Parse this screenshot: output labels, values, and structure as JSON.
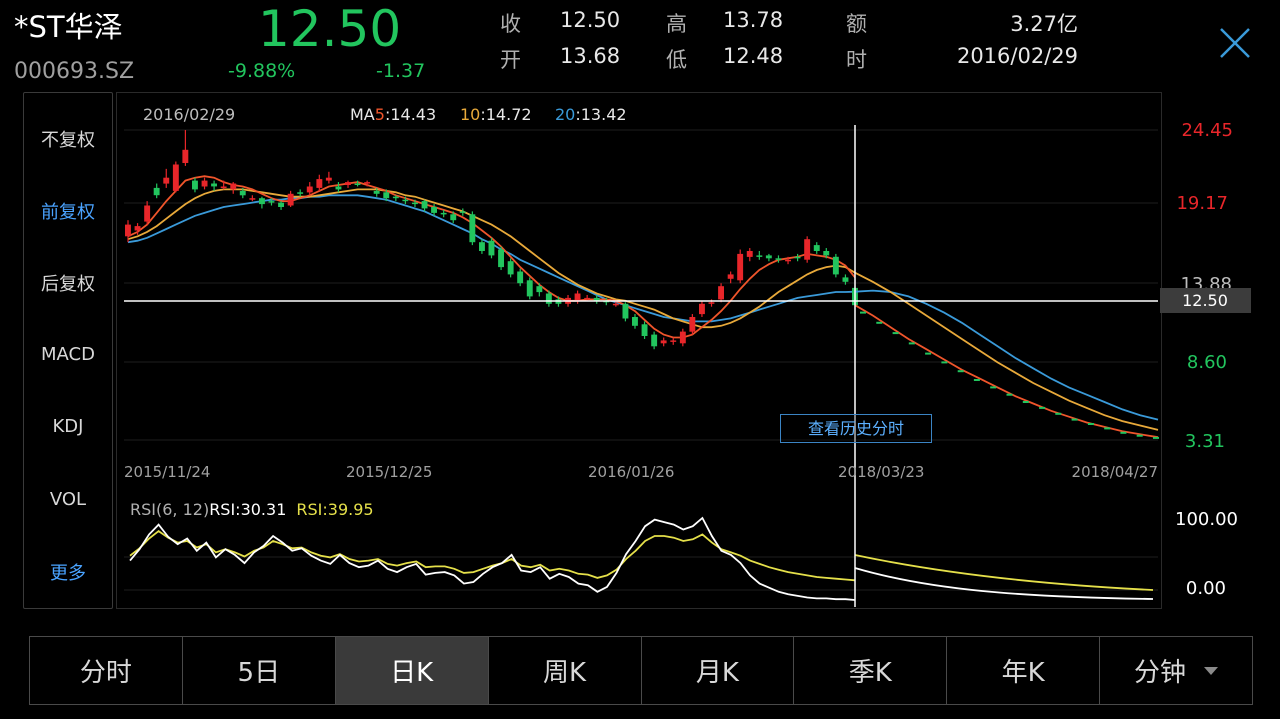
{
  "header": {
    "name": "*ST华泽",
    "code": "000693.SZ",
    "price": "12.50",
    "change_pct": "-9.88%",
    "change_abs": "-1.37",
    "quote": [
      {
        "label": "收",
        "value": "12.50"
      },
      {
        "label": "开",
        "value": "13.68"
      },
      {
        "label": "高",
        "value": "13.78"
      },
      {
        "label": "低",
        "value": "12.48"
      },
      {
        "label": "额",
        "value": "3.27亿"
      },
      {
        "label": "时",
        "value": "2016/02/29"
      }
    ]
  },
  "sidebar": {
    "items": [
      {
        "label": "不复权",
        "active": false
      },
      {
        "label": "前复权",
        "active": true
      },
      {
        "label": "后复权",
        "active": false
      },
      {
        "label": "MACD",
        "active": false
      },
      {
        "label": "KDJ",
        "active": false
      },
      {
        "label": "VOL",
        "active": false
      },
      {
        "label": "更多",
        "active": true
      }
    ]
  },
  "kline": {
    "date_label": "2016/02/29",
    "ma_prefix": "MA",
    "ma5_key": "5",
    "ma5_val": ":14.43",
    "ma10_key": "10",
    "ma10_val": ":14.72",
    "ma20_key": "20",
    "ma20_val": ":13.42",
    "price_ticks": [
      "24.45",
      "19.17",
      "13.88",
      "8.60",
      "3.31"
    ],
    "crosshair_value": "12.50",
    "date_ticks": [
      "2015/11/24",
      "2015/12/25",
      "2016/01/26",
      "2018/03/23",
      "2018/04/27"
    ],
    "history_button": "查看历史分时"
  },
  "rsi": {
    "label": "RSI(6, 12)",
    "rsi6": "RSI:30.31",
    "rsi12": "RSI:39.95",
    "ticks": [
      "100.00",
      "0.00"
    ]
  },
  "tabs": [
    {
      "label": "分时",
      "active": false
    },
    {
      "label": "5日",
      "active": false
    },
    {
      "label": "日K",
      "active": true
    },
    {
      "label": "周K",
      "active": false
    },
    {
      "label": "月K",
      "active": false
    },
    {
      "label": "季K",
      "active": false
    },
    {
      "label": "年K",
      "active": false
    },
    {
      "label": "分钟",
      "active": false
    }
  ],
  "colors": {
    "up": "#e8262a",
    "down": "#22c55e",
    "ma5": "#f0552b",
    "ma10": "#e8a93a",
    "ma20": "#3a9ad9",
    "rsi6": "#ffffff",
    "rsi12": "#e5e04a",
    "accent": "#4aa3ff"
  },
  "chart_data": {
    "type": "candlestick",
    "title": "",
    "ylim": [
      3.31,
      24.45
    ],
    "candles": [
      {
        "o": 17.2,
        "c": 18.0,
        "h": 18.3,
        "l": 16.8
      },
      {
        "o": 17.6,
        "c": 17.9,
        "h": 18.1,
        "l": 17.3
      },
      {
        "o": 18.2,
        "c": 19.3,
        "h": 19.6,
        "l": 18.0
      },
      {
        "o": 20.5,
        "c": 20.0,
        "h": 20.8,
        "l": 19.8
      },
      {
        "o": 20.8,
        "c": 21.2,
        "h": 21.8,
        "l": 20.5
      },
      {
        "o": 20.3,
        "c": 22.1,
        "h": 22.3,
        "l": 20.2
      },
      {
        "o": 22.2,
        "c": 23.1,
        "h": 24.45,
        "l": 22.0
      },
      {
        "o": 21.0,
        "c": 20.4,
        "h": 21.2,
        "l": 20.2
      },
      {
        "o": 20.6,
        "c": 21.0,
        "h": 21.2,
        "l": 20.4
      },
      {
        "o": 20.8,
        "c": 20.6,
        "h": 21.0,
        "l": 20.3
      },
      {
        "o": 20.6,
        "c": 20.6,
        "h": 21.0,
        "l": 20.4
      },
      {
        "o": 20.4,
        "c": 20.8,
        "h": 20.9,
        "l": 20.1
      },
      {
        "o": 20.3,
        "c": 20.0,
        "h": 20.5,
        "l": 19.8
      },
      {
        "o": 19.8,
        "c": 19.8,
        "h": 20.0,
        "l": 19.6
      },
      {
        "o": 19.8,
        "c": 19.4,
        "h": 19.9,
        "l": 19.1
      },
      {
        "o": 19.6,
        "c": 19.5,
        "h": 19.8,
        "l": 19.3
      },
      {
        "o": 19.5,
        "c": 19.2,
        "h": 19.6,
        "l": 19.0
      },
      {
        "o": 19.3,
        "c": 20.1,
        "h": 20.3,
        "l": 19.2
      },
      {
        "o": 20.2,
        "c": 20.1,
        "h": 20.4,
        "l": 19.9
      },
      {
        "o": 20.2,
        "c": 20.6,
        "h": 20.9,
        "l": 20.0
      },
      {
        "o": 20.5,
        "c": 21.1,
        "h": 21.4,
        "l": 20.3
      },
      {
        "o": 21.0,
        "c": 21.2,
        "h": 21.6,
        "l": 20.8
      },
      {
        "o": 20.6,
        "c": 20.4,
        "h": 20.9,
        "l": 20.2
      },
      {
        "o": 20.7,
        "c": 20.9,
        "h": 21.0,
        "l": 20.5
      },
      {
        "o": 20.8,
        "c": 20.7,
        "h": 21.0,
        "l": 20.6
      },
      {
        "o": 20.8,
        "c": 20.9,
        "h": 21.0,
        "l": 20.6
      },
      {
        "o": 20.3,
        "c": 20.1,
        "h": 20.5,
        "l": 19.9
      },
      {
        "o": 20.2,
        "c": 19.8,
        "h": 20.4,
        "l": 19.6
      },
      {
        "o": 19.9,
        "c": 19.8,
        "h": 20.0,
        "l": 19.6
      },
      {
        "o": 19.7,
        "c": 19.6,
        "h": 19.9,
        "l": 19.4
      },
      {
        "o": 19.5,
        "c": 19.4,
        "h": 19.7,
        "l": 19.2
      },
      {
        "o": 19.6,
        "c": 19.1,
        "h": 19.7,
        "l": 18.9
      },
      {
        "o": 19.2,
        "c": 18.8,
        "h": 19.4,
        "l": 18.6
      },
      {
        "o": 18.8,
        "c": 18.7,
        "h": 19.0,
        "l": 18.5
      },
      {
        "o": 18.7,
        "c": 18.3,
        "h": 18.9,
        "l": 18.1
      },
      {
        "o": 18.9,
        "c": 18.8,
        "h": 19.1,
        "l": 18.6
      },
      {
        "o": 18.7,
        "c": 16.8,
        "h": 18.9,
        "l": 16.6
      },
      {
        "o": 16.8,
        "c": 16.2,
        "h": 17.0,
        "l": 16.0
      },
      {
        "o": 16.9,
        "c": 15.9,
        "h": 17.1,
        "l": 15.7
      },
      {
        "o": 16.3,
        "c": 15.1,
        "h": 16.5,
        "l": 14.9
      },
      {
        "o": 15.5,
        "c": 14.6,
        "h": 15.7,
        "l": 14.4
      },
      {
        "o": 14.8,
        "c": 14.0,
        "h": 15.0,
        "l": 13.8
      },
      {
        "o": 14.2,
        "c": 13.1,
        "h": 14.4,
        "l": 12.9
      },
      {
        "o": 13.8,
        "c": 13.4,
        "h": 14.0,
        "l": 13.1
      },
      {
        "o": 13.3,
        "c": 12.6,
        "h": 13.5,
        "l": 12.4
      },
      {
        "o": 12.9,
        "c": 12.6,
        "h": 13.1,
        "l": 12.4
      },
      {
        "o": 12.6,
        "c": 13.0,
        "h": 13.2,
        "l": 12.4
      },
      {
        "o": 12.8,
        "c": 13.3,
        "h": 13.5,
        "l": 12.6
      },
      {
        "o": 13.0,
        "c": 13.0,
        "h": 13.2,
        "l": 12.8
      },
      {
        "o": 13.0,
        "c": 12.8,
        "h": 13.2,
        "l": 12.6
      },
      {
        "o": 12.8,
        "c": 12.7,
        "h": 13.0,
        "l": 12.5
      },
      {
        "o": 12.6,
        "c": 12.6,
        "h": 12.8,
        "l": 12.4
      },
      {
        "o": 12.6,
        "c": 11.6,
        "h": 12.7,
        "l": 11.4
      },
      {
        "o": 11.7,
        "c": 11.1,
        "h": 11.9,
        "l": 10.9
      },
      {
        "o": 11.2,
        "c": 10.4,
        "h": 11.4,
        "l": 10.2
      },
      {
        "o": 10.5,
        "c": 9.7,
        "h": 10.7,
        "l": 9.5
      },
      {
        "o": 9.9,
        "c": 10.1,
        "h": 10.3,
        "l": 9.7
      },
      {
        "o": 10.0,
        "c": 10.1,
        "h": 10.3,
        "l": 9.8
      },
      {
        "o": 9.9,
        "c": 10.7,
        "h": 10.9,
        "l": 9.7
      },
      {
        "o": 10.7,
        "c": 11.7,
        "h": 11.9,
        "l": 10.5
      },
      {
        "o": 11.9,
        "c": 12.6,
        "h": 12.8,
        "l": 11.7
      },
      {
        "o": 12.6,
        "c": 12.7,
        "h": 12.9,
        "l": 12.4
      },
      {
        "o": 12.9,
        "c": 13.8,
        "h": 14.0,
        "l": 12.7
      },
      {
        "o": 14.3,
        "c": 14.6,
        "h": 14.8,
        "l": 14.0
      },
      {
        "o": 14.2,
        "c": 16.0,
        "h": 16.3,
        "l": 14.0
      },
      {
        "o": 15.8,
        "c": 16.2,
        "h": 16.4,
        "l": 15.5
      },
      {
        "o": 15.9,
        "c": 15.8,
        "h": 16.2,
        "l": 15.6
      },
      {
        "o": 15.9,
        "c": 15.7,
        "h": 16.0,
        "l": 15.5
      },
      {
        "o": 15.7,
        "c": 15.6,
        "h": 15.9,
        "l": 15.4
      },
      {
        "o": 15.6,
        "c": 15.6,
        "h": 15.8,
        "l": 15.3
      },
      {
        "o": 15.8,
        "c": 15.7,
        "h": 16.0,
        "l": 15.5
      },
      {
        "o": 15.6,
        "c": 17.0,
        "h": 17.2,
        "l": 15.4
      },
      {
        "o": 16.6,
        "c": 16.2,
        "h": 16.8,
        "l": 16.0
      },
      {
        "o": 16.2,
        "c": 15.9,
        "h": 16.4,
        "l": 15.7
      },
      {
        "o": 15.8,
        "c": 14.6,
        "h": 16.0,
        "l": 14.4
      },
      {
        "o": 14.4,
        "c": 14.1,
        "h": 14.6,
        "l": 13.9
      },
      {
        "o": 13.68,
        "c": 12.5,
        "h": 13.78,
        "l": 12.48
      }
    ],
    "ma5": [
      17.2,
      17.5,
      18.0,
      18.8,
      19.6,
      20.3,
      21.0,
      21.2,
      21.3,
      21.2,
      20.9,
      20.7,
      20.6,
      20.4,
      20.1,
      19.8,
      19.6,
      19.6,
      19.8,
      20.0,
      20.3,
      20.6,
      20.7,
      20.8,
      20.9,
      20.7,
      20.5,
      20.3,
      20.0,
      19.8,
      19.6,
      19.4,
      19.2,
      19.0,
      18.8,
      18.5,
      18.1,
      17.6,
      17.1,
      16.5,
      15.8,
      15.1,
      14.5,
      13.9,
      13.4,
      13.0,
      12.8,
      12.8,
      12.9,
      12.9,
      12.9,
      12.8,
      12.5,
      12.1,
      11.5,
      10.9,
      10.5,
      10.3,
      10.3,
      10.5,
      11.0,
      11.5,
      12.1,
      12.8,
      13.6,
      14.3,
      14.9,
      15.3,
      15.6,
      15.7,
      15.8,
      16.0,
      15.9,
      15.8,
      15.6,
      15.2,
      14.4
    ],
    "ma10": [
      17.0,
      17.2,
      17.5,
      17.9,
      18.4,
      18.9,
      19.4,
      19.8,
      20.1,
      20.3,
      20.4,
      20.4,
      20.4,
      20.3,
      20.2,
      20.1,
      20.0,
      19.9,
      19.9,
      19.9,
      20.0,
      20.1,
      20.2,
      20.3,
      20.4,
      20.4,
      20.4,
      20.3,
      20.2,
      20.0,
      19.9,
      19.7,
      19.5,
      19.3,
      19.1,
      18.9,
      18.6,
      18.3,
      18.0,
      17.6,
      17.2,
      16.7,
      16.2,
      15.7,
      15.2,
      14.7,
      14.3,
      13.9,
      13.6,
      13.3,
      13.1,
      12.9,
      12.8,
      12.6,
      12.4,
      12.2,
      11.9,
      11.6,
      11.4,
      11.2,
      11.0,
      11.0,
      11.1,
      11.3,
      11.6,
      12.0,
      12.4,
      12.9,
      13.4,
      13.8,
      14.2,
      14.6,
      14.9,
      15.1,
      15.2,
      15.1,
      14.72
    ],
    "ma20": [
      16.8,
      16.9,
      17.1,
      17.4,
      17.7,
      18.0,
      18.3,
      18.6,
      18.8,
      19.0,
      19.2,
      19.3,
      19.4,
      19.5,
      19.6,
      19.7,
      19.7,
      19.8,
      19.8,
      19.9,
      19.9,
      20.0,
      20.0,
      20.0,
      20.0,
      19.9,
      19.8,
      19.7,
      19.5,
      19.3,
      19.1,
      18.9,
      18.6,
      18.3,
      18.0,
      17.7,
      17.4,
      17.0,
      16.7,
      16.3,
      16.0,
      15.6,
      15.3,
      15.0,
      14.7,
      14.4,
      14.1,
      13.8,
      13.5,
      13.2,
      12.9,
      12.7,
      12.5,
      12.3,
      12.1,
      11.9,
      11.7,
      11.6,
      11.5,
      11.4,
      11.4,
      11.4,
      11.5,
      11.6,
      11.8,
      12.0,
      12.2,
      12.4,
      12.6,
      12.8,
      13.0,
      13.1,
      13.2,
      13.3,
      13.4,
      13.4,
      13.42
    ],
    "projection_ma5": [
      12.5,
      11.8,
      11.0,
      10.2,
      9.5,
      8.8,
      8.1,
      7.5,
      6.9,
      6.3,
      5.8,
      5.3,
      4.9,
      4.5,
      4.2,
      3.9,
      3.7,
      3.5
    ],
    "projection_ma10": [
      14.72,
      14.1,
      13.4,
      12.6,
      11.8,
      11.0,
      10.2,
      9.4,
      8.6,
      7.9,
      7.2,
      6.6,
      6.0,
      5.5,
      5.0,
      4.6,
      4.3,
      4.0
    ],
    "projection_ma20": [
      13.42,
      13.5,
      13.4,
      13.1,
      12.6,
      12.0,
      11.3,
      10.5,
      9.7,
      8.9,
      8.2,
      7.5,
      6.9,
      6.4,
      5.9,
      5.4,
      5.0,
      4.7
    ],
    "projection_dots": [
      12.0,
      11.3,
      10.6,
      9.9,
      9.2,
      8.6,
      8.0,
      7.4,
      6.9,
      6.4,
      5.9,
      5.5,
      5.1,
      4.7,
      4.4,
      4.1,
      3.8,
      3.6,
      3.45
    ],
    "rsi_ylim": [
      0,
      100
    ],
    "rsi6_values": [
      48,
      62,
      80,
      92,
      77,
      68,
      75,
      60,
      70,
      52,
      62,
      55,
      45,
      58,
      66,
      78,
      70,
      60,
      63,
      54,
      48,
      44,
      55,
      45,
      40,
      42,
      48,
      38,
      34,
      40,
      44,
      31,
      33,
      34,
      30,
      20,
      22,
      32,
      40,
      45,
      55,
      36,
      34,
      40,
      26,
      32,
      28,
      20,
      18,
      10,
      16,
      33,
      56,
      72,
      90,
      98,
      95,
      92,
      86,
      90,
      100,
      78,
      60,
      55,
      45,
      30,
      20,
      15,
      10,
      7,
      5,
      3,
      2,
      2,
      1,
      1,
      0
    ],
    "rsi12_values": [
      54,
      63,
      75,
      84,
      76,
      70,
      72,
      64,
      68,
      58,
      62,
      58,
      53,
      60,
      64,
      72,
      68,
      63,
      64,
      58,
      54,
      52,
      56,
      50,
      47,
      48,
      50,
      44,
      42,
      45,
      47,
      40,
      41,
      41,
      38,
      33,
      34,
      38,
      42,
      45,
      50,
      42,
      40,
      43,
      36,
      38,
      36,
      32,
      31,
      27,
      30,
      37,
      50,
      60,
      72,
      78,
      78,
      76,
      72,
      74,
      80,
      70,
      62,
      58,
      54,
      48,
      44,
      40,
      37,
      34,
      32,
      30,
      28,
      27,
      26,
      25,
      24
    ]
  }
}
